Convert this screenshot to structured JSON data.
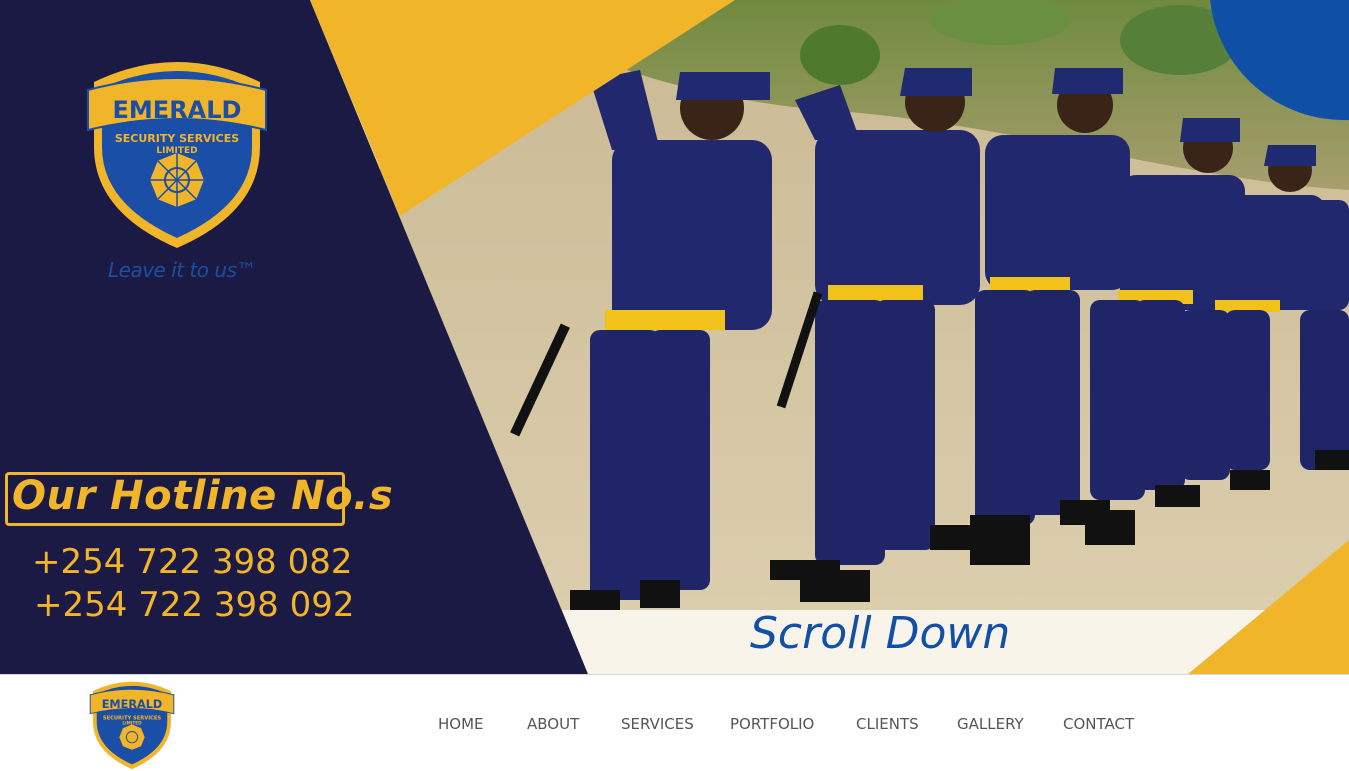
{
  "brand": {
    "name": "EMERALD",
    "line1": "SECURITY SERVICES",
    "line2": "LIMITED",
    "tagline": "Leave it to us™"
  },
  "hero": {
    "hotline_title": "Our Hotline No.s",
    "phones": [
      "+254 722 398 082",
      "+254 722 398 092"
    ],
    "scroll_label": "Scroll Down"
  },
  "nav": {
    "items": [
      "HOME",
      "ABOUT",
      "SERVICES",
      "PORTFOLIO",
      "CLIENTS",
      "GALLERY",
      "CONTACT"
    ]
  },
  "colors": {
    "navy": "#1b1a44",
    "gold": "#f1b52a",
    "blue": "#0f4fa6",
    "uniform": "#22286e"
  }
}
